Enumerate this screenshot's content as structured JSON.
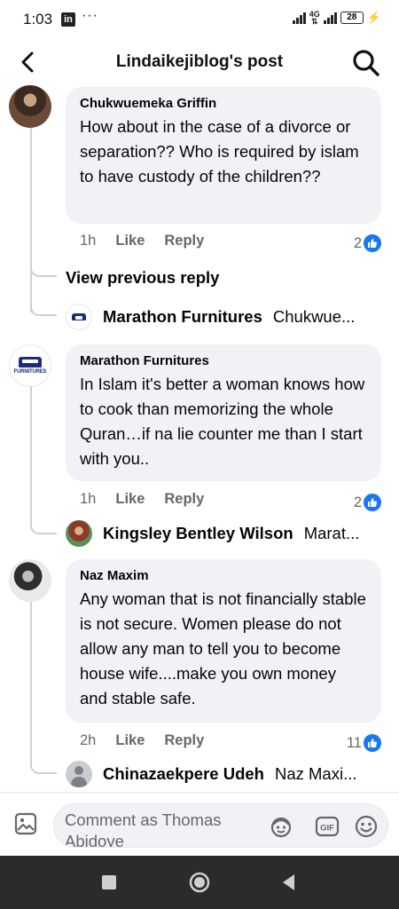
{
  "status": {
    "time": "1:03",
    "app_badge": "in",
    "more": "···",
    "network": "4G",
    "battery": "28"
  },
  "header": {
    "title": "Lindaikejiblog's post"
  },
  "comments": [
    {
      "author": "Chukwuemeka Griffin",
      "text": "How about in the case of a divorce or separation?? Who is required by islam to have custody of the children??",
      "time": "1h",
      "like_label": "Like",
      "reply_label": "Reply",
      "reactions": "2"
    },
    {
      "author": "Marathon Furnitures",
      "text": "In Islam it's better a woman knows how to cook than memorizing the whole Quran…if na lie counter me than I start with you..",
      "time": "1h",
      "like_label": "Like",
      "reply_label": "Reply",
      "reactions": "2"
    },
    {
      "author": "Naz Maxim",
      "text": "Any woman that is not financially stable is not secure. Women please do not allow any man to tell you to become house wife....make you own money and stable safe.",
      "time": "2h",
      "like_label": "Like",
      "reply_label": "Reply",
      "reactions": "11"
    }
  ],
  "view_previous": "View previous reply",
  "reply_previews": [
    {
      "name": "Marathon Furnitures",
      "snippet": "Chukwue..."
    },
    {
      "name": "Kingsley Bentley Wilson",
      "snippet": "Marat..."
    },
    {
      "name": "Chinazaekpere Udeh",
      "snippet": "Naz Maxi..."
    }
  ],
  "composer": {
    "placeholder": "Comment as Thomas Abidoye",
    "gif_label": "GIF"
  },
  "logo_text": "FURNITURES",
  "colors": {
    "accent": "#1877f2",
    "bubble": "#f0f2f5",
    "secondary_text": "#65676b",
    "nav_bar": "#2b2b2b"
  }
}
